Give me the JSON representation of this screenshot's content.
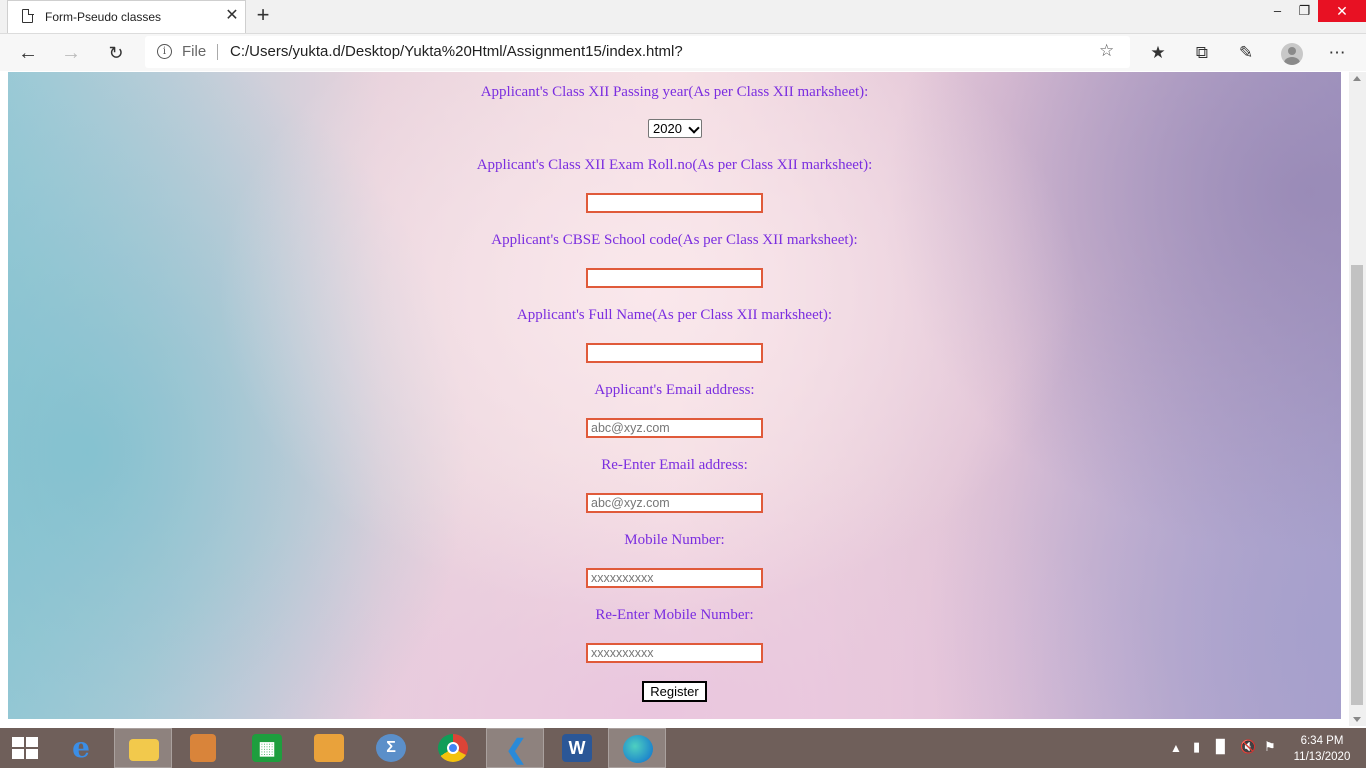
{
  "browser": {
    "tab_title": "Form-Pseudo classes",
    "tab_close": "✕",
    "new_tab": "+",
    "window_min": "–",
    "window_max": "❐",
    "window_close": "✕",
    "address_scheme": "File",
    "address_url": "C:/Users/yukta.d/Desktop/Yukta%20Html/Assignment15/index.html?",
    "icons": [
      "page-icon",
      "back-icon",
      "forward-icon",
      "reload-icon",
      "info-icon",
      "favorite-star-icon",
      "favorites-icon",
      "collections-icon",
      "share-icon",
      "profile-icon",
      "more-icon"
    ]
  },
  "form": {
    "passing_year_label": "Applicant's Class XII Passing year(As per Class XII marksheet):",
    "passing_year_value": "2020",
    "roll_label": "Applicant's Class XII Exam Roll.no(As per Class XII marksheet):",
    "roll_value": "",
    "school_code_label": "Applicant's CBSE School code(As per Class XII marksheet):",
    "school_code_value": "",
    "full_name_label": "Applicant's Full Name(As per Class XII marksheet):",
    "full_name_value": "",
    "email_label": "Applicant's Email address:",
    "email_placeholder": "abc@xyz.com",
    "reemail_label": "Re-Enter Email address:",
    "reemail_placeholder": "abc@xyz.com",
    "mobile_label": "Mobile Number:",
    "mobile_placeholder": "xxxxxxxxxx",
    "remobile_label": "Re-Enter Mobile Number:",
    "remobile_placeholder": "xxxxxxxxxx",
    "register_label": "Register"
  },
  "colors": {
    "label": "#7b2ee0",
    "input_border": "#e05a3a",
    "taskbar": "#6f5f5a",
    "close_button": "#e81123"
  },
  "taskbar": {
    "apps": [
      "start-button",
      "internet-explorer-icon",
      "file-explorer-icon",
      "media-icon",
      "store-icon",
      "control-panel-icon",
      "math-icon",
      "chrome-icon",
      "vscode-icon",
      "word-icon",
      "edge-icon"
    ],
    "time": "6:34 PM",
    "date": "11/13/2020"
  }
}
